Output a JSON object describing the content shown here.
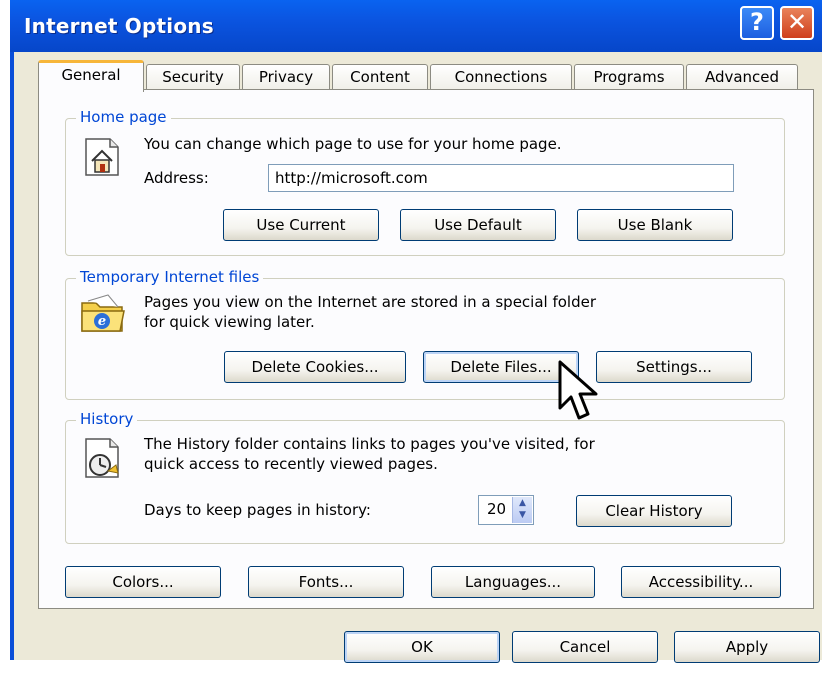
{
  "window": {
    "title": "Internet Options",
    "help_glyph": "?",
    "close_glyph": "✕"
  },
  "tabs": [
    "General",
    "Security",
    "Privacy",
    "Content",
    "Connections",
    "Programs",
    "Advanced"
  ],
  "home_page": {
    "label": "Home page",
    "description": "You can change which page to use for your home page.",
    "address_label": "Address:",
    "address_value": "http://microsoft.com",
    "buttons": {
      "use_current": "Use Current",
      "use_default": "Use Default",
      "use_blank": "Use Blank"
    }
  },
  "temp_files": {
    "label": "Temporary Internet files",
    "description_line1": "Pages you view on the Internet are stored in a special folder",
    "description_line2": "for quick viewing later.",
    "buttons": {
      "delete_cookies": "Delete Cookies...",
      "delete_files": "Delete Files...",
      "settings": "Settings..."
    }
  },
  "history": {
    "label": "History",
    "description_line1": "The History folder contains links to pages you've visited, for",
    "description_line2": "quick access to recently viewed pages.",
    "days_label": "Days to keep pages in history:",
    "days_value": "20",
    "clear_button": "Clear History"
  },
  "bottom_buttons": {
    "colors": "Colors...",
    "fonts": "Fonts...",
    "languages": "Languages...",
    "accessibility": "Accessibility..."
  },
  "dialog_buttons": {
    "ok": "OK",
    "cancel": "Cancel",
    "apply": "Apply"
  },
  "colors": {
    "title_blue": "#0a4ed8",
    "group_label": "#0046d5",
    "face": "#ece9d8",
    "close_red": "#cf3f1c"
  },
  "icons": {
    "home": "home-page-icon",
    "temp": "temp-files-folder-icon",
    "history": "history-clock-icon",
    "cursor": "mouse-pointer-icon"
  }
}
